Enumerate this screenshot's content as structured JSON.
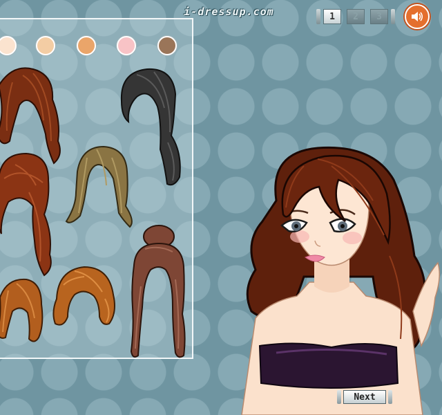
{
  "site": {
    "logo_text": "i-dressup.com"
  },
  "pager": {
    "pages": [
      {
        "label": "1",
        "state": "active"
      },
      {
        "label": "2",
        "state": "inactive"
      },
      {
        "label": "3",
        "state": "inactive"
      }
    ]
  },
  "sound": {
    "icon": "speaker-icon"
  },
  "skin_swatches": [
    {
      "name": "fair",
      "color": "#fbe3cf"
    },
    {
      "name": "light",
      "color": "#f3cda4"
    },
    {
      "name": "tan",
      "color": "#eaa56a"
    },
    {
      "name": "rosy",
      "color": "#f8c3c6"
    },
    {
      "name": "brown",
      "color": "#9a7559"
    }
  ],
  "hair_options": [
    {
      "name": "wavy-auburn",
      "color": "#7a2e12"
    },
    {
      "name": "wavy-black",
      "color": "#2f2f2f"
    },
    {
      "name": "long-auburn-bangs",
      "color": "#8b3414"
    },
    {
      "name": "straight-olive",
      "color": "#8a7443"
    },
    {
      "name": "short-copper",
      "color": "#b25e1e"
    },
    {
      "name": "bob-copper",
      "color": "#b8641f"
    },
    {
      "name": "updo-brown",
      "color": "#7e4635"
    }
  ],
  "avatar": {
    "hair_color": "#5e200c",
    "skin_color": "#fbe1cc",
    "top_color": "#2b1531"
  },
  "navigation": {
    "next_label": "Next"
  }
}
